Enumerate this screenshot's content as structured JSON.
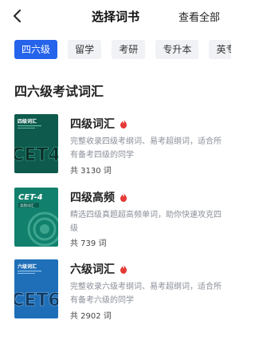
{
  "header": {
    "title": "选择词书",
    "view_all": "查看全部"
  },
  "tabs": [
    {
      "label": "四六级",
      "active": true
    },
    {
      "label": "留学",
      "active": false
    },
    {
      "label": "考研",
      "active": false
    },
    {
      "label": "专升本",
      "active": false
    },
    {
      "label": "英专",
      "active": false
    }
  ],
  "section": {
    "title": "四六级考试词汇"
  },
  "books": [
    {
      "name": "四级词汇",
      "desc": "完整收录四级考纲词、易考超纲词，适合所有备考四级的同学",
      "count": "共 3130 词",
      "cover": {
        "label": "四级词汇",
        "big": "CET4",
        "color": "#0e5b4d"
      }
    },
    {
      "name": "四级高频",
      "desc": "精选四级真题超高频单词，助你快速攻克四级",
      "count": "共 739 词",
      "cover": {
        "label": "CET-4",
        "sub": "高频词汇",
        "color": "#11806d"
      }
    },
    {
      "name": "六级词汇",
      "desc": "完整收录六级考纲词、易考超纲词，适合所有备考六级的同学",
      "count": "共 2902 词",
      "cover": {
        "label": "六级词汇",
        "big": "CET6",
        "color": "#1f6fb8"
      }
    }
  ],
  "colors": {
    "accent": "#2563eb",
    "hot": "#e53935"
  }
}
